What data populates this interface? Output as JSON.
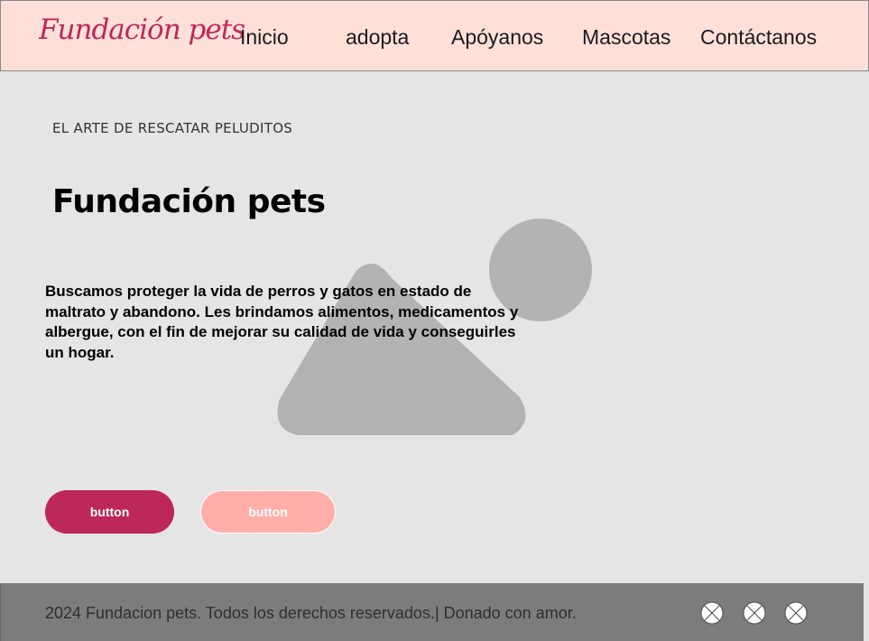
{
  "header": {
    "logo_text": "Fundación pets",
    "nav": [
      {
        "label": "Inicio"
      },
      {
        "label": "adopta"
      },
      {
        "label": "Apóyanos"
      },
      {
        "label": "Mascotas"
      },
      {
        "label": "Contáctanos"
      }
    ]
  },
  "hero": {
    "eyebrow": "EL ARTE DE RESCATAR PELUDITOS",
    "title": "Fundación pets",
    "description": "Buscamos proteger la vida de perros y gatos en estado de maltrato y abandono. Les brindamos alimentos, medicamentos y albergue, con el fin de mejorar su calidad de vida y conseguirles un hogar.",
    "image_icon": "image-placeholder-icon"
  },
  "buttons": {
    "primary_label": "button",
    "secondary_label": "button"
  },
  "footer": {
    "copyright": "2024 Fundacion pets. Todos los derechos reservados.| Donado con amor.",
    "social_icons": [
      "social-icon",
      "social-icon",
      "social-icon"
    ]
  },
  "colors": {
    "brand": "#c02658",
    "primary_button": "#bd275a",
    "secondary_button": "#ffaeaa",
    "header_bg": "#fee0d9",
    "page_bg": "#e5e5e5",
    "footer_bg": "#7c7c7c"
  }
}
